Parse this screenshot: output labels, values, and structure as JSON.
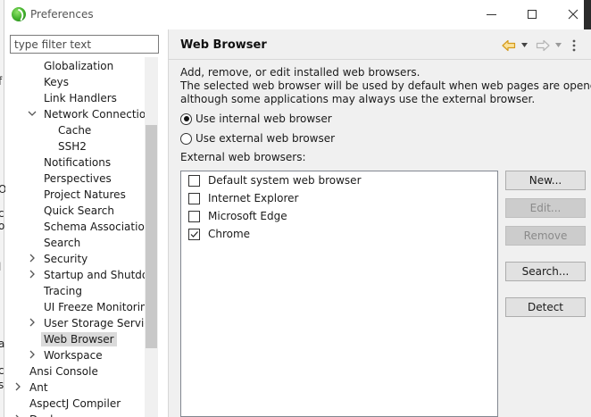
{
  "window": {
    "title": "Preferences"
  },
  "filter": {
    "placeholder": "type filter text"
  },
  "tree": {
    "items": [
      {
        "label": "Globalization",
        "twisty": "none"
      },
      {
        "label": "Keys",
        "twisty": "none"
      },
      {
        "label": "Link Handlers",
        "twisty": "none"
      },
      {
        "label": "Network Connections",
        "twisty": "expanded"
      },
      {
        "label": "Cache",
        "twisty": "none"
      },
      {
        "label": "SSH2",
        "twisty": "none"
      },
      {
        "label": "Notifications",
        "twisty": "none"
      },
      {
        "label": "Perspectives",
        "twisty": "none"
      },
      {
        "label": "Project Natures",
        "twisty": "none"
      },
      {
        "label": "Quick Search",
        "twisty": "none"
      },
      {
        "label": "Schema Associations",
        "twisty": "none"
      },
      {
        "label": "Search",
        "twisty": "none"
      },
      {
        "label": "Security",
        "twisty": "collapsed"
      },
      {
        "label": "Startup and Shutdown",
        "twisty": "collapsed"
      },
      {
        "label": "Tracing",
        "twisty": "none"
      },
      {
        "label": "UI Freeze Monitoring",
        "twisty": "none"
      },
      {
        "label": "User Storage Service",
        "twisty": "collapsed"
      },
      {
        "label": "Web Browser",
        "twisty": "none"
      },
      {
        "label": "Workspace",
        "twisty": "collapsed"
      },
      {
        "label": "Ansi Console",
        "twisty": "none"
      },
      {
        "label": "Ant",
        "twisty": "collapsed"
      },
      {
        "label": "AspectJ Compiler",
        "twisty": "none"
      },
      {
        "label": "Docker",
        "twisty": "collapsed"
      }
    ],
    "selected": "Web Browser"
  },
  "page": {
    "title": "Web Browser",
    "desc_line1": "Add, remove, or edit installed web browsers.",
    "desc_line2": "The selected web browser will be used by default when web pages are opened,",
    "desc_line3": "although some applications may always use the external browser.",
    "radio_internal": "Use internal web browser",
    "radio_external": "Use external web browser",
    "radio_selected": "internal",
    "list_label": "External web browsers:",
    "browsers": [
      {
        "name": "Default system web browser",
        "checked": false
      },
      {
        "name": "Internet Explorer",
        "checked": false
      },
      {
        "name": "Microsoft Edge",
        "checked": false
      },
      {
        "name": "Chrome",
        "checked": true
      }
    ],
    "buttons": {
      "new": "New...",
      "edit": "Edit...",
      "remove": "Remove",
      "search": "Search...",
      "detect": "Detect"
    }
  },
  "colors": {
    "nav_arrow": "#e0a82e",
    "selection": "#dadada",
    "panel": "#f0f0f0"
  },
  "icons": {
    "app": "eclipse-icon",
    "back": "back-arrow-icon",
    "forward": "forward-arrow-icon",
    "menu": "view-menu-icon"
  }
}
